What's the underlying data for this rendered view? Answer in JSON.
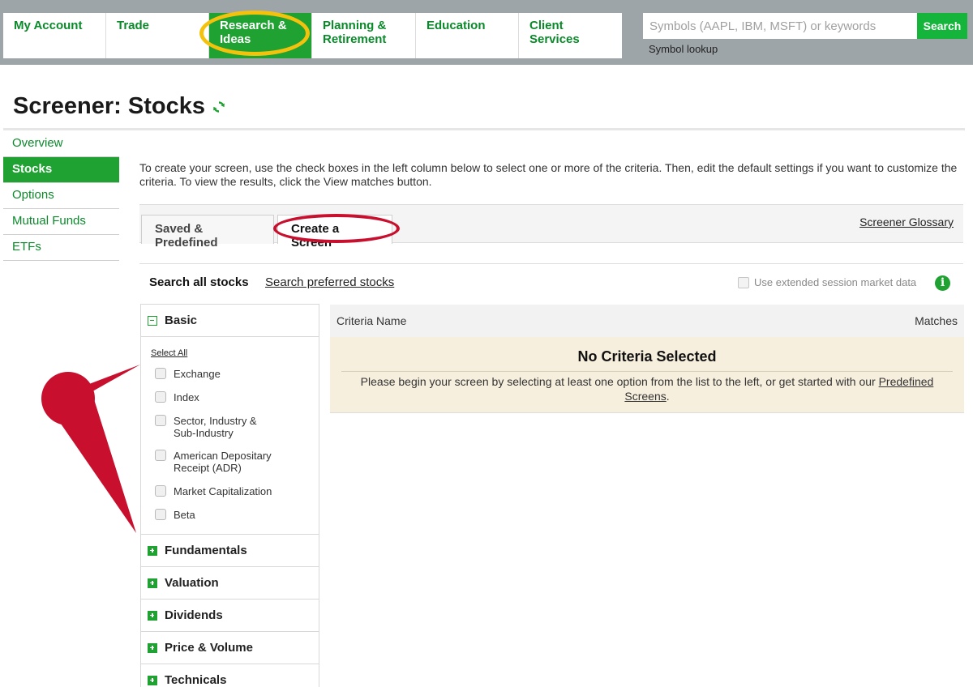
{
  "nav": {
    "items": [
      {
        "label": "My Account"
      },
      {
        "label": "Trade"
      },
      {
        "label": "Research & Ideas"
      },
      {
        "label": "Planning & Retirement"
      },
      {
        "label": "Education"
      },
      {
        "label": "Client Services"
      }
    ],
    "active_index": 2,
    "search_placeholder": "Symbols (AAPL, IBM, MSFT) or keywords",
    "search_button": "Search",
    "symbol_lookup": "Symbol lookup"
  },
  "page": {
    "title": "Screener: Stocks"
  },
  "leftnav": {
    "items": [
      {
        "label": "Overview"
      },
      {
        "label": "Stocks"
      },
      {
        "label": "Options"
      },
      {
        "label": "Mutual Funds"
      },
      {
        "label": "ETFs"
      }
    ],
    "active_index": 1
  },
  "intro": "To create your screen, use the check boxes in the left column below to select one or more of the criteria. Then, edit the default settings if you want to customize the criteria. To view the results, click the View matches button.",
  "tabs": {
    "items": [
      {
        "label": "Saved & Predefined"
      },
      {
        "label": "Create a Screen"
      }
    ],
    "active_index": 1,
    "glossary": "Screener Glossary"
  },
  "search_row": {
    "all": "Search all stocks",
    "preferred": "Search preferred stocks",
    "extended": "Use extended session market data",
    "extended_checked": false
  },
  "criteria": {
    "basic": {
      "label": "Basic",
      "select_all": "Select All",
      "options": [
        {
          "label": "Exchange",
          "checked": false
        },
        {
          "label": "Index",
          "checked": false
        },
        {
          "label": "Sector, Industry & Sub-Industry",
          "checked": false
        },
        {
          "label": "American Depositary Receipt (ADR)",
          "checked": false
        },
        {
          "label": "Market Capitalization",
          "checked": false
        },
        {
          "label": "Beta",
          "checked": false
        }
      ]
    },
    "sections": [
      {
        "label": "Fundamentals"
      },
      {
        "label": "Valuation"
      },
      {
        "label": "Dividends"
      },
      {
        "label": "Price & Volume"
      },
      {
        "label": "Technicals"
      }
    ]
  },
  "results": {
    "col_name": "Criteria Name",
    "col_matches": "Matches",
    "empty_title": "No Criteria Selected",
    "empty_msg": "Please begin your screen by selecting at least one option from the list to the left, or get started with our",
    "empty_link": "Predefined Screens",
    "empty_end": "."
  },
  "colors": {
    "brand_green": "#1fa232",
    "link_green": "#0a8a2a",
    "highlight_yellow": "#f4c20d",
    "annotation_red": "#c8102e",
    "empty_bg": "#f7efdd"
  }
}
